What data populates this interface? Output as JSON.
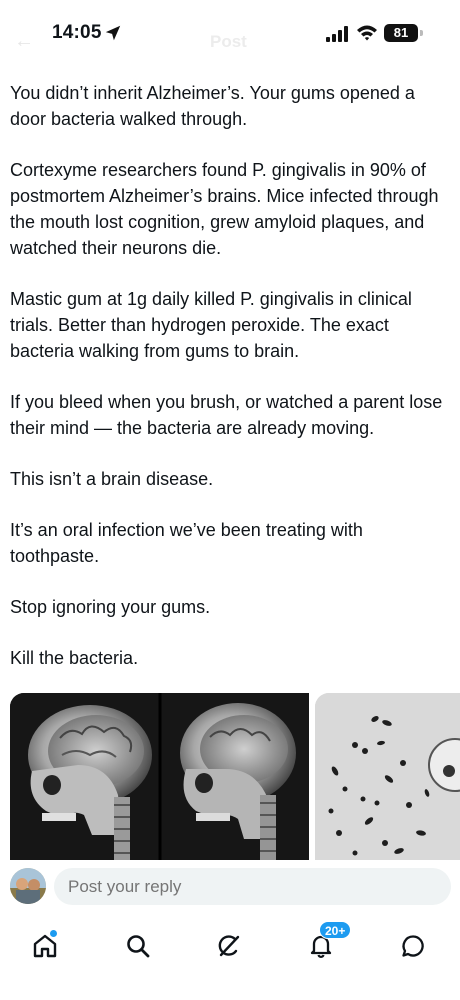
{
  "status_bar": {
    "time": "14:05",
    "battery": "81",
    "icons": [
      "location-arrow-icon",
      "cellular-signal-icon",
      "wifi-icon",
      "battery-icon"
    ]
  },
  "header": {
    "title": "Post"
  },
  "post": {
    "paragraphs": [
      "You didn’t inherit Alzheimer’s. Your gums opened a door bacteria walked through.",
      "Cortexyme researchers found P. gingivalis in 90% of postmortem Alzheimer’s brains. Mice infected through the mouth lost cognition, grew amyloid plaques, and watched their neurons die.",
      "Mastic gum at 1g daily killed P. gingivalis in clinical trials. Better than hydrogen peroxide. The exact bacteria walking from gums to brain.",
      "If you bleed when you brush, or watched a parent lose their mind — the bacteria are already moving.",
      "This isn’t a brain disease.",
      "It’s an oral infection we’ve been treating with toothpaste.",
      "Stop ignoring your gums.",
      "Kill the bacteria."
    ],
    "media": [
      {
        "kind": "image",
        "subject": "skull-xray-brain-image"
      },
      {
        "kind": "image",
        "subject": "bacteria-micrograph-image"
      }
    ]
  },
  "reply": {
    "placeholder": "Post your reply"
  },
  "tab_bar": {
    "tabs": [
      {
        "name": "home",
        "icon": "home-icon",
        "active": true,
        "dot": true
      },
      {
        "name": "search",
        "icon": "search-icon"
      },
      {
        "name": "grok",
        "icon": "grok-icon"
      },
      {
        "name": "notifications",
        "icon": "bell-icon",
        "badge": "20+"
      },
      {
        "name": "messages",
        "icon": "chat-bubble-icon"
      }
    ]
  },
  "colors": {
    "accent": "#1d9bf0",
    "text": "#0f1419",
    "muted": "#536471",
    "input_bg": "#eff3f4"
  }
}
